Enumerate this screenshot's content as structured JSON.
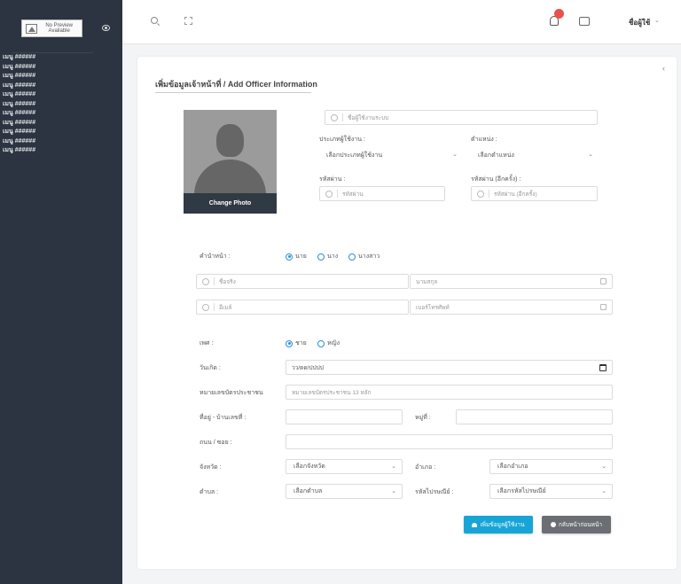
{
  "sidebar": {
    "logo_text": "No Preview Available",
    "menu": [
      "เมนู ######",
      "เมนู ######",
      "เมนู ######",
      "เมนู ######",
      "เมนู ######",
      "เมนู ######",
      "เมนู ######",
      "เมนู ######",
      "เมนู ######",
      "เมนู ######",
      "เมนู ######"
    ]
  },
  "topbar": {
    "user_name": "ชื่อผู้ใช้",
    "caret": "⌄"
  },
  "page": {
    "title": "เพิ่มข้อมูลเจ้าหน้าที่ / Add Officer Information",
    "change_photo": "Change Photo"
  },
  "account": {
    "username_placeholder": "ชื่อผู้ใช้งานระบบ",
    "user_type_label": "ประเภทผู้ใช้งาน :",
    "user_type_value": "เลือกประเภทผู้ใช้งาน",
    "position_label": "ตำแหน่ง :",
    "position_value": "เลือกตำแหน่ง",
    "password_label": "รหัสผ่าน :",
    "password_placeholder": "รหัสผ่าน",
    "password2_label": "รหัสผ่าน (อีกครั้ง) :",
    "password2_placeholder": "รหัสผ่าน (อีกครั้ง)"
  },
  "personal": {
    "prefix_label": "คำนำหน้า :",
    "prefix_options": [
      "นาย",
      "นาง",
      "นางสาว"
    ],
    "first_name_placeholder": "ชื่อจริง",
    "last_name_placeholder": "นามสกุล",
    "email_placeholder": "อีเมล์",
    "phone_placeholder": "เบอร์โทรศัพท์",
    "gender_label": "เพศ :",
    "gender_options": [
      "ชาย",
      "หญิง"
    ],
    "birthdate_label": "วันเกิด :",
    "birthdate_placeholder": "วว/ดด/ปปปป",
    "id_card_label": "หมายเลขบัตรประชาชน",
    "id_card_placeholder": "หมายเลขบัตรประชาชน 13 หลัก",
    "address_label": "ที่อยู่ - บ้านเลขที่ :",
    "moo_label": "หมู่ที่ :",
    "road_label": "ถนน / ซอย :",
    "province_label": "จังหวัด :",
    "province_value": "เลือกจังหวัด",
    "district_label": "อำเภอ :",
    "district_value": "เลือกอำเภอ",
    "subdistrict_label": "ตำบล :",
    "subdistrict_value": "เลือกตำบล",
    "postal_label": "รหัสไปรษณีย์ :",
    "postal_value": "เลือกรหัสไปรษณีย์"
  },
  "buttons": {
    "save": "เพิ่มข้อมูลผู้ใช้งาน",
    "back": "กลับหน้าก่อนหน้า"
  },
  "colors": {
    "sidebar": "#2b3440",
    "primary": "#16a5d6",
    "secondary": "#6b6f73",
    "badge": "#e8524b"
  }
}
